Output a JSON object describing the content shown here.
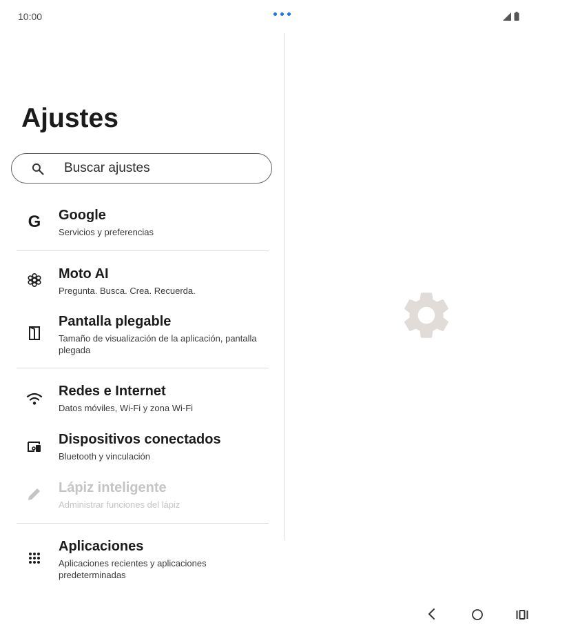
{
  "status_bar": {
    "time": "10:00"
  },
  "header": {
    "title": "Ajustes"
  },
  "search": {
    "placeholder": "Buscar ajustes"
  },
  "items": [
    {
      "id": "google",
      "title": "Google",
      "subtitle": "Servicios y preferencias",
      "icon": "google-g-icon"
    },
    {
      "id": "moto-ai",
      "title": "Moto AI",
      "subtitle": "Pregunta. Busca. Crea. Recuerda.",
      "icon": "moto-ai-icon"
    },
    {
      "id": "pantalla",
      "title": "Pantalla plegable",
      "subtitle": "Tamaño de visualización de la aplicación, pantalla plegada",
      "icon": "foldable-screen-icon"
    },
    {
      "id": "redes",
      "title": "Redes e Internet",
      "subtitle": "Datos móviles, Wi-Fi y zona Wi-Fi",
      "icon": "wifi-icon"
    },
    {
      "id": "dispositivos",
      "title": "Dispositivos conectados",
      "subtitle": "Bluetooth y vinculación",
      "icon": "connected-devices-icon"
    },
    {
      "id": "lapiz",
      "title": "Lápiz inteligente",
      "subtitle": "Administrar funciones del lápiz",
      "icon": "pen-icon",
      "disabled": true
    },
    {
      "id": "aplicaciones",
      "title": "Aplicaciones",
      "subtitle": "Aplicaciones recientes y aplicaciones predeterminadas",
      "icon": "apps-grid-icon"
    }
  ],
  "colors": {
    "accent": "#1a73e8",
    "gear": "#e2dcd9",
    "disabled": "#c4c4c4"
  }
}
